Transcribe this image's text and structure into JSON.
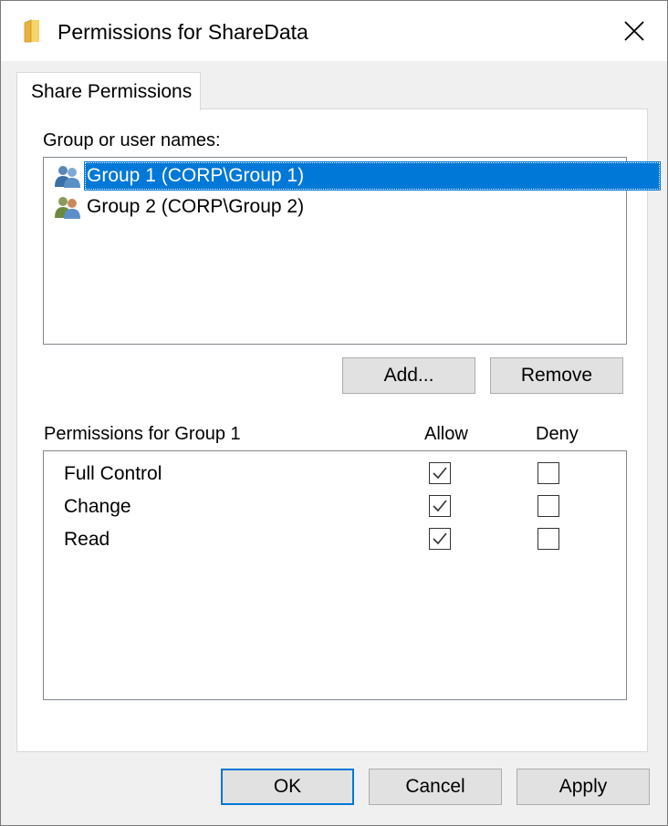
{
  "window": {
    "title": "Permissions for ShareData",
    "title_icon": "folder-icon",
    "close_icon": "close-icon"
  },
  "tabs": [
    {
      "label": "Share Permissions",
      "active": true
    }
  ],
  "groups_section": {
    "label": "Group or user names:",
    "items": [
      {
        "label": "Group 1 (CORP\\Group 1)",
        "icon": "group-users-icon",
        "selected": true
      },
      {
        "label": "Group 2 (CORP\\Group 2)",
        "icon": "group-users-icon",
        "selected": false
      }
    ],
    "add_label": "Add...",
    "remove_label": "Remove"
  },
  "permissions_section": {
    "label": "Permissions for Group 1",
    "allow_header": "Allow",
    "deny_header": "Deny",
    "rows": [
      {
        "name": "Full Control",
        "allow": true,
        "deny": false
      },
      {
        "name": "Change",
        "allow": true,
        "deny": false
      },
      {
        "name": "Read",
        "allow": true,
        "deny": false
      }
    ]
  },
  "footer": {
    "ok_label": "OK",
    "cancel_label": "Cancel",
    "apply_label": "Apply"
  },
  "colors": {
    "selection": "#0078d7",
    "dialog_background": "#f0f0f0",
    "button_face": "#e1e1e1"
  }
}
